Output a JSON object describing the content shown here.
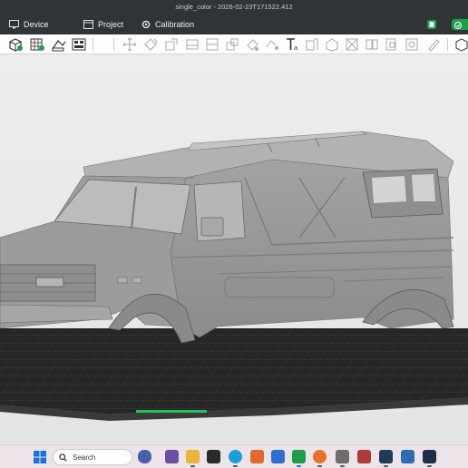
{
  "window": {
    "title": "single_color - 2026-02-23T171522.412"
  },
  "tabs": [
    {
      "label": "Device",
      "icon": "monitor-icon"
    },
    {
      "label": "Project",
      "icon": "project-icon"
    },
    {
      "label": "Calibration",
      "icon": "calibration-icon"
    }
  ],
  "toolbar": {
    "tools": [
      "add-object-icon",
      "grid-plate-icon",
      "add-plate-icon",
      "arrange-icon",
      "move-icon",
      "rotate-icon",
      "scale-icon",
      "place-on-face-icon",
      "cut-icon",
      "support-paint-icon",
      "color-paint-icon",
      "text-icon",
      "variable-layer-icon",
      "assembly-icon",
      "measure-icon",
      "split-objects-icon",
      "split-parts-icon",
      "brim-ears-icon",
      "seam-icon"
    ]
  },
  "model": {
    "name": "van-body-model"
  },
  "taskbar": {
    "search_placeholder": "Search",
    "apps": [
      "widgets-icon",
      "file-explorer-icon",
      "terminal-icon",
      "edge-icon",
      "office-icon",
      "slicer-app-icon",
      "green-app-icon",
      "firefox-icon",
      "calculator-icon",
      "paint-icon",
      "photo-icon",
      "store-icon",
      "blue-app-icon"
    ]
  },
  "colors": {
    "titlebar": "#2f3437",
    "accent_green": "#1e9e4a",
    "model_grey": "#9a9a9a",
    "plate": "#2c2c2c"
  }
}
